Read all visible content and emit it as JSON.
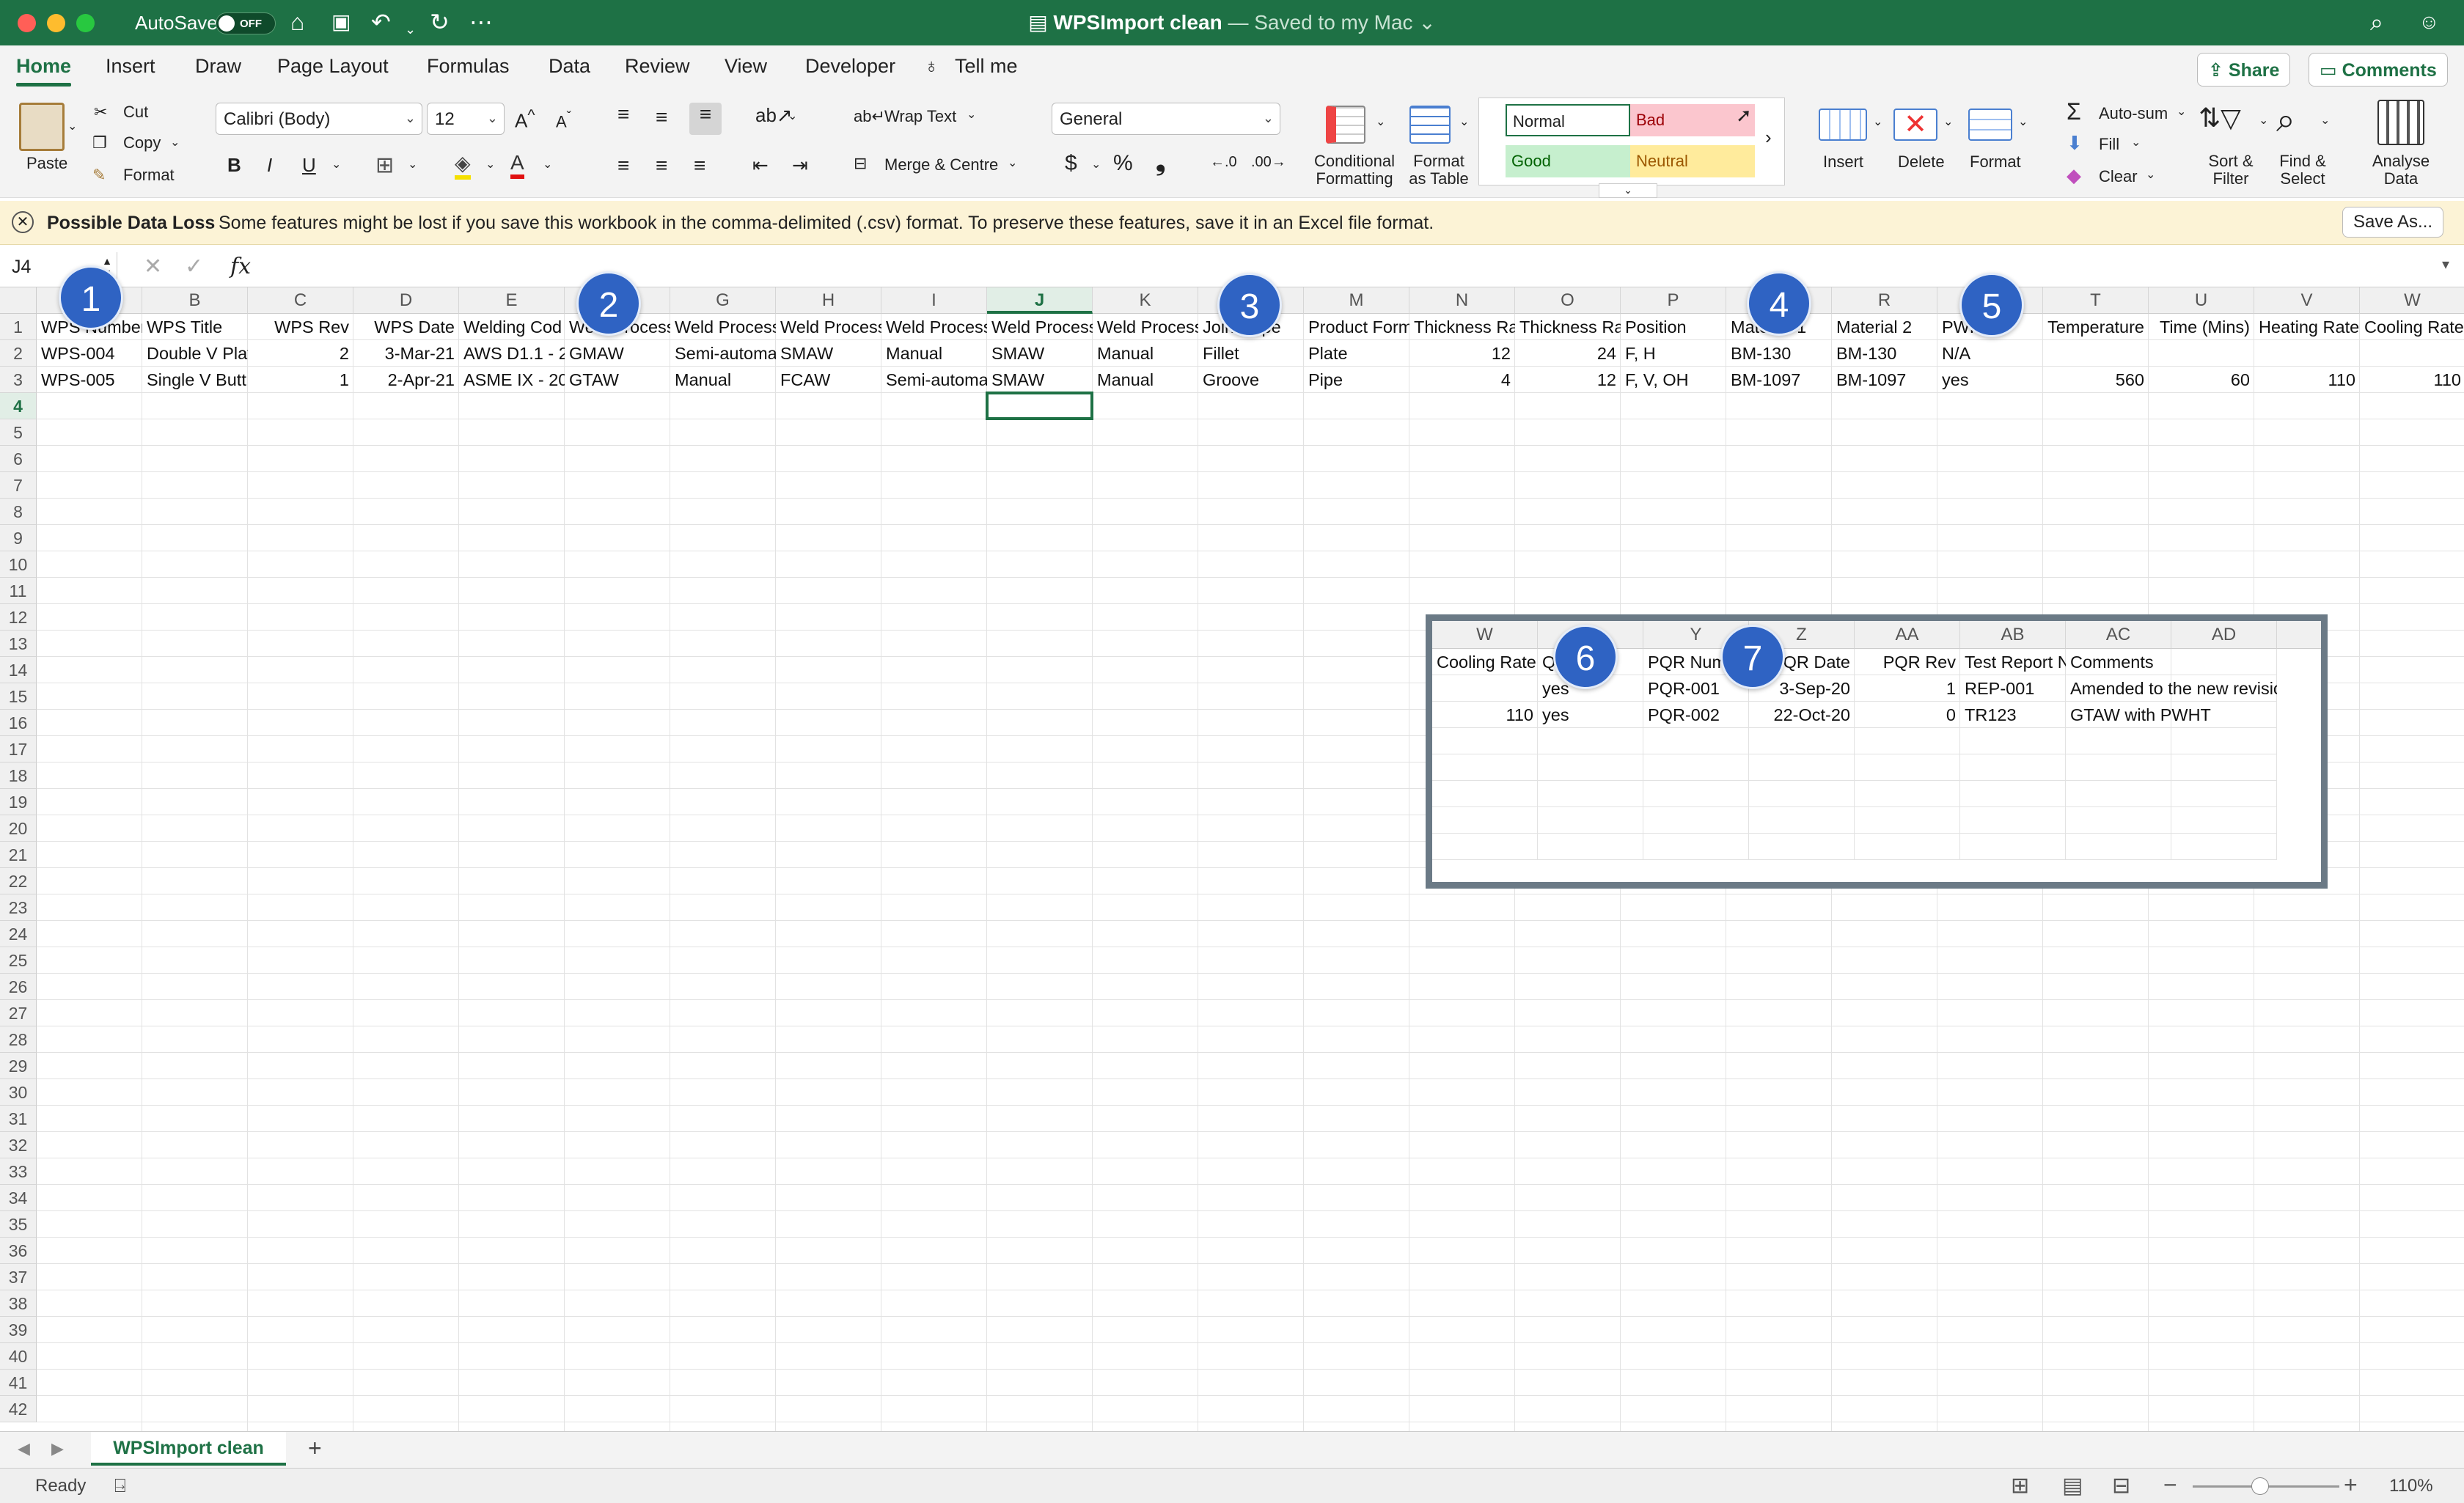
{
  "titlebar": {
    "autosave_label": "AutoSave",
    "autosave_state": "OFF",
    "doc_name": "WPSImport clean",
    "doc_status": "— Saved to my Mac"
  },
  "tabs": {
    "items": [
      "Home",
      "Insert",
      "Draw",
      "Page Layout",
      "Formulas",
      "Data",
      "Review",
      "View",
      "Developer"
    ],
    "tell_me": "Tell me",
    "share": "Share",
    "comments": "Comments"
  },
  "ribbon": {
    "paste": "Paste",
    "cut": "Cut",
    "copy": "Copy",
    "format_painter": "Format",
    "font_name": "Calibri (Body)",
    "font_size": "12",
    "bold": "B",
    "italic": "I",
    "underline": "U",
    "wrap_text": "Wrap Text",
    "merge_centre": "Merge & Centre",
    "number_format": "General",
    "currency": "$",
    "percent": "%",
    "comma": "❟",
    "conditional_formatting": [
      "Conditional",
      "Formatting"
    ],
    "format_as_table": [
      "Format",
      "as Table"
    ],
    "styles": {
      "normal": "Normal",
      "bad": "Bad",
      "good": "Good",
      "neutral": "Neutral"
    },
    "insert": "Insert",
    "delete": "Delete",
    "format": "Format",
    "autosum": "Auto-sum",
    "fill": "Fill",
    "clear": "Clear",
    "sort_filter": [
      "Sort &",
      "Filter"
    ],
    "find_select": [
      "Find &",
      "Select"
    ],
    "analyse_data": [
      "Analyse",
      "Data"
    ]
  },
  "warning": {
    "title": "Possible Data Loss",
    "message": "Some features might be lost if you save this workbook in the comma-delimited (.csv) format. To preserve these features, save it in an Excel file format.",
    "save_as": "Save As..."
  },
  "formula_bar": {
    "name_box": "J4",
    "fx": "fx",
    "value": ""
  },
  "sheet": {
    "columns": [
      "A",
      "B",
      "C",
      "D",
      "E",
      "F",
      "G",
      "H",
      "I",
      "J",
      "K",
      "L",
      "M",
      "N",
      "O",
      "P",
      "Q",
      "R",
      "S",
      "T",
      "U",
      "V",
      "W"
    ],
    "selected_col": "J",
    "selected_row": 4,
    "rows": [
      [
        "WPS Number",
        "WPS Title",
        "WPS Rev",
        "WPS Date",
        "Welding Cod",
        "Weld Process",
        "Weld Process",
        "Weld Process",
        "Weld Process",
        "Weld Process",
        "Weld Process",
        "Joint Type",
        "Product Form",
        "Thickness Ran",
        "Thickness Ran",
        "Position",
        "Material 1",
        "Material 2",
        "PWHT",
        "Temperature",
        "Time (Mins)",
        "Heating Rate",
        "Cooling Rate"
      ],
      [
        "WPS-004",
        "Double V Plat",
        "2",
        "3-Mar-21",
        "AWS D1.1 - 2",
        "GMAW",
        "Semi-automa",
        "SMAW",
        "Manual",
        "SMAW",
        "Manual",
        "Fillet",
        "Plate",
        "12",
        "24",
        "F, H",
        "BM-130",
        "BM-130",
        "N/A",
        "",
        "",
        "",
        ""
      ],
      [
        "WPS-005",
        "Single V Butt",
        "1",
        "2-Apr-21",
        "ASME IX - 20",
        "GTAW",
        "Manual",
        "FCAW",
        "Semi-automa",
        "SMAW",
        "Manual",
        "Groove",
        "Pipe",
        "4",
        "12",
        "F, V, OH",
        "BM-1097",
        "BM-1097",
        "yes",
        "560",
        "60",
        "110",
        "110"
      ]
    ],
    "numeric_cols": [
      2,
      3,
      13,
      14,
      19,
      20,
      21,
      22
    ]
  },
  "overlay": {
    "columns": [
      "W",
      "X",
      "Y",
      "Z",
      "AA",
      "AB",
      "AC",
      "AD"
    ],
    "rows": [
      [
        "Cooling Rate",
        "Qualified",
        "PQR Number",
        "PQR Date",
        "PQR Rev",
        "Test Report N",
        "Comments",
        ""
      ],
      [
        "",
        "yes",
        "PQR-001",
        "3-Sep-20",
        "1",
        "REP-001",
        "Amended to the new revision",
        ""
      ],
      [
        "110",
        "yes",
        "PQR-002",
        "22-Oct-20",
        "0",
        "TR123",
        "GTAW with PWHT",
        ""
      ]
    ],
    "numeric_cols": [
      0,
      3,
      4
    ]
  },
  "badges": [
    "1",
    "2",
    "3",
    "4",
    "5",
    "6",
    "7"
  ],
  "sheet_tab": "WPSImport clean",
  "status": {
    "ready": "Ready",
    "zoom": "110%"
  }
}
